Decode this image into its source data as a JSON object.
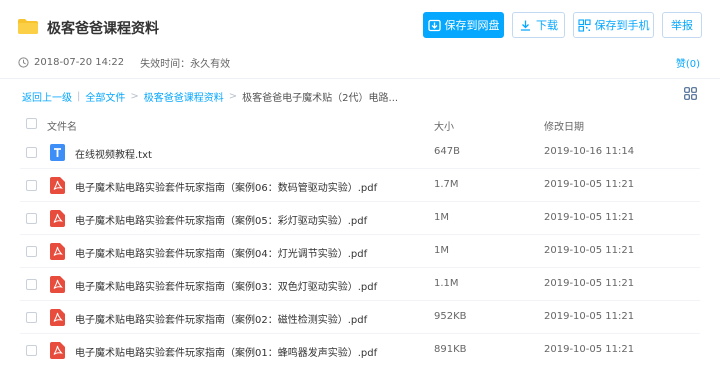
{
  "header": {
    "title": "极客爸爸课程资料",
    "save_to_disk": "保存到网盘",
    "download": "下载",
    "save_to_phone": "保存到手机",
    "report": "举报"
  },
  "meta": {
    "datetime": "2018-07-20 14:22",
    "expire_label": "失效时间：永久有效",
    "like": "赞(0)"
  },
  "breadcrumb": {
    "back": "返回上一级",
    "sep1": "|",
    "all_files": "全部文件",
    "sep2": ">",
    "folder": "极客爸爸课程资料",
    "sep3": ">",
    "current": "极客爸爸电子魔术贴（2代）电路..."
  },
  "table": {
    "headers": {
      "name": "文件名",
      "size": "大小",
      "date": "修改日期"
    },
    "rows": [
      {
        "icon": "txt-file-icon",
        "name": "在线视频教程.txt",
        "size": "647B",
        "date": "2019-10-16 11:14"
      },
      {
        "icon": "pdf-file-icon",
        "name": "电子魔术贴电路实验套件玩家指南（案例06：数码管驱动实验）.pdf",
        "size": "1.7M",
        "date": "2019-10-05 11:21"
      },
      {
        "icon": "pdf-file-icon",
        "name": "电子魔术贴电路实验套件玩家指南（案例05：彩灯驱动实验）.pdf",
        "size": "1M",
        "date": "2019-10-05 11:21"
      },
      {
        "icon": "pdf-file-icon",
        "name": "电子魔术贴电路实验套件玩家指南（案例04：灯光调节实验）.pdf",
        "size": "1M",
        "date": "2019-10-05 11:21"
      },
      {
        "icon": "pdf-file-icon",
        "name": "电子魔术贴电路实验套件玩家指南（案例03：双色灯驱动实验）.pdf",
        "size": "1.1M",
        "date": "2019-10-05 11:21"
      },
      {
        "icon": "pdf-file-icon",
        "name": "电子魔术贴电路实验套件玩家指南（案例02：磁性检测实验）.pdf",
        "size": "952KB",
        "date": "2019-10-05 11:21"
      },
      {
        "icon": "pdf-file-icon",
        "name": "电子魔术贴电路实验套件玩家指南（案例01：蜂鸣器发声实验）.pdf",
        "size": "891KB",
        "date": "2019-10-05 11:21"
      }
    ]
  },
  "colors": {
    "accent": "#06a7ff",
    "folder": "#f8c42e",
    "pdf": "#e74c3c",
    "txt": "#3e8ef7"
  }
}
